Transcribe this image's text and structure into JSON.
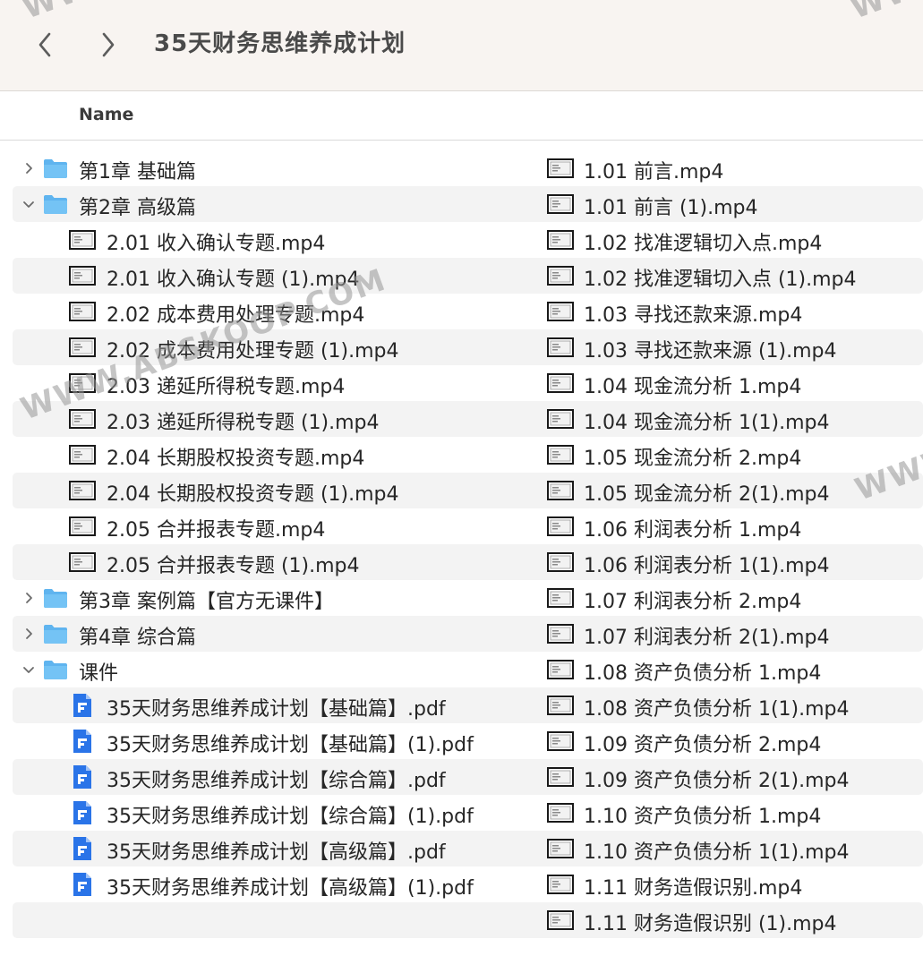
{
  "window": {
    "title": "35天财务思维养成计划"
  },
  "header": {
    "name_column": "Name"
  },
  "left_column": [
    {
      "type": "folder",
      "label": "第1章 基础篇",
      "expanded": false,
      "level": 0
    },
    {
      "type": "folder",
      "label": "第2章 高级篇",
      "expanded": true,
      "level": 0
    },
    {
      "type": "video",
      "label": "2.01 收入确认专题.mp4",
      "level": 1
    },
    {
      "type": "video",
      "label": "2.01 收入确认专题 (1).mp4",
      "level": 1
    },
    {
      "type": "video",
      "label": "2.02 成本费用处理专题.mp4",
      "level": 1
    },
    {
      "type": "video",
      "label": "2.02 成本费用处理专题 (1).mp4",
      "level": 1
    },
    {
      "type": "video",
      "label": "2.03 递延所得税专题.mp4",
      "level": 1
    },
    {
      "type": "video",
      "label": "2.03 递延所得税专题 (1).mp4",
      "level": 1
    },
    {
      "type": "video",
      "label": "2.04 长期股权投资专题.mp4",
      "level": 1
    },
    {
      "type": "video",
      "label": "2.04 长期股权投资专题 (1).mp4",
      "level": 1
    },
    {
      "type": "video",
      "label": "2.05 合并报表专题.mp4",
      "level": 1
    },
    {
      "type": "video",
      "label": "2.05 合并报表专题 (1).mp4",
      "level": 1
    },
    {
      "type": "folder",
      "label": "第3章 案例篇【官方无课件】",
      "expanded": false,
      "level": 0
    },
    {
      "type": "folder",
      "label": "第4章 综合篇",
      "expanded": false,
      "level": 0
    },
    {
      "type": "folder",
      "label": "课件",
      "expanded": true,
      "level": 0
    },
    {
      "type": "pdf",
      "label": "35天财务思维养成计划【基础篇】.pdf",
      "level": 1
    },
    {
      "type": "pdf",
      "label": "35天财务思维养成计划【基础篇】(1).pdf",
      "level": 1
    },
    {
      "type": "pdf",
      "label": "35天财务思维养成计划【综合篇】.pdf",
      "level": 1
    },
    {
      "type": "pdf",
      "label": "35天财务思维养成计划【综合篇】(1).pdf",
      "level": 1
    },
    {
      "type": "pdf",
      "label": "35天财务思维养成计划【高级篇】.pdf",
      "level": 1
    },
    {
      "type": "pdf",
      "label": "35天财务思维养成计划【高级篇】(1).pdf",
      "level": 1
    }
  ],
  "right_column": [
    "1.01 前言.mp4",
    "1.01 前言 (1).mp4",
    "1.02 找准逻辑切入点.mp4",
    "1.02 找准逻辑切入点 (1).mp4",
    "1.03 寻找还款来源.mp4",
    "1.03 寻找还款来源 (1).mp4",
    "1.04 现金流分析 1.mp4",
    "1.04 现金流分析 1(1).mp4",
    "1.05 现金流分析 2.mp4",
    "1.05 现金流分析 2(1).mp4",
    "1.06 利润表分析 1.mp4",
    "1.06 利润表分析 1(1).mp4",
    "1.07 利润表分析 2.mp4",
    "1.07 利润表分析 2(1).mp4",
    "1.08 资产负债分析 1.mp4",
    "1.08 资产负债分析 1(1).mp4",
    "1.09 资产负债分析 2.mp4",
    "1.09 资产负债分析 2(1).mp4",
    "1.10 资产负债分析 1.mp4",
    "1.10 资产负债分析 1(1).mp4",
    "1.11 财务造假识别.mp4",
    "1.11 财务造假识别 (1).mp4"
  ],
  "watermarks": [
    "WWW.ABSKOOP.COM",
    "WWW.",
    "WWW.",
    "WWW."
  ],
  "colors": {
    "folder": "#5fb4ef",
    "pdf": "#2a74e8",
    "stripe": "#f3f3f3",
    "toolbar": "#f8f4f1"
  }
}
